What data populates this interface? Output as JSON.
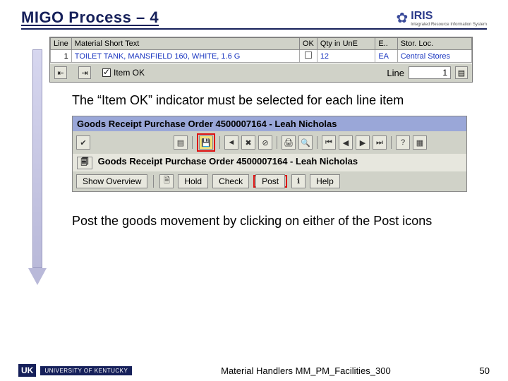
{
  "title": "MIGO Process – 4",
  "logo": {
    "text": "IRIS",
    "sub": "Integrated Resource\nInformation System"
  },
  "table": {
    "headers": [
      "Line",
      "Material Short Text",
      "OK",
      "Qty in UnE",
      "E..",
      "Stor. Loc."
    ],
    "row": {
      "line": "1",
      "desc": "TOILET TANK, MANSFIELD 160, WHITE, 1.6 G",
      "qty": "12",
      "unit": "EA",
      "stor": "Central Stores"
    }
  },
  "itemok_bar": {
    "label": "Item OK",
    "line_label": "Line",
    "line_value": "1"
  },
  "callout1": "The “Item OK” indicator must be selected for each line item",
  "header2": "Goods Receipt Purchase Order 4500007164 - Leah Nicholas",
  "header3": "Goods Receipt Purchase Order 4500007164 - Leah Nicholas",
  "buttons": {
    "show_overview": "Show Overview",
    "hold": "Hold",
    "check": "Check",
    "post": "Post",
    "help": "Help"
  },
  "callout2": "Post the goods movement by clicking on either of the Post icons",
  "footer": {
    "course": "Material Handlers MM_PM_Facilities_300",
    "page": "50",
    "uk": "UNIVERSITY OF KENTUCKY",
    "uk_mark": "UK"
  }
}
